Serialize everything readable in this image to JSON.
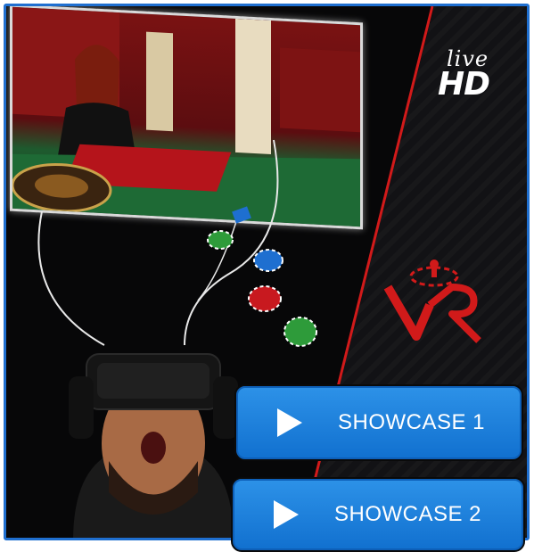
{
  "brand": {
    "live_label": "live",
    "hd_label": "HD"
  },
  "buttons": [
    {
      "label": "SHOWCASE 1",
      "icon": "play-icon"
    },
    {
      "label": "SHOWCASE 2",
      "icon": "play-icon"
    }
  ],
  "colors": {
    "frame_border": "#1f6fd0",
    "button_blue": "#1a7fd8",
    "accent_red": "#d11a1a",
    "chip_blue": "#1e6fd0",
    "chip_red": "#c8191f",
    "chip_green": "#2e9b3a"
  }
}
